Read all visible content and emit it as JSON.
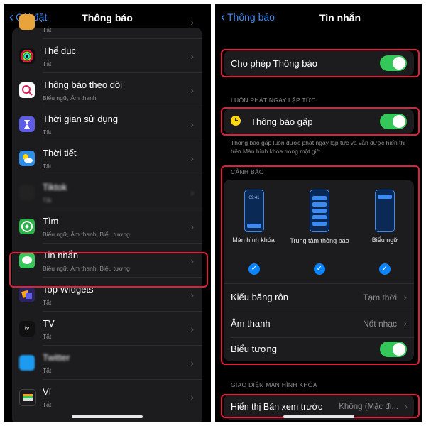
{
  "left": {
    "back_label": "Cài đặt",
    "title": "Thông báo",
    "items": [
      {
        "name": "",
        "sub": "Tắt"
      },
      {
        "name": "Thể dục",
        "sub": "Tắt"
      },
      {
        "name": "Thông báo theo dõi",
        "sub": "Biểu ngữ, Âm thanh"
      },
      {
        "name": "Thời gian sử dụng",
        "sub": "Tắt"
      },
      {
        "name": "Thời tiết",
        "sub": "Tắt"
      },
      {
        "name": "Tiktok",
        "sub": "Tắt"
      },
      {
        "name": "Tìm",
        "sub": "Biểu ngữ, Âm thanh, Biểu tượng"
      },
      {
        "name": "Tin nhắn",
        "sub": "Biểu ngữ, Âm thanh, Biểu tượng"
      },
      {
        "name": "Top Widgets",
        "sub": "Tắt"
      },
      {
        "name": "TV",
        "sub": "Tắt"
      },
      {
        "name": "Twitter",
        "sub": "Tắt"
      },
      {
        "name": "Ví",
        "sub": "Tắt"
      }
    ],
    "tv_icon_text": "tv"
  },
  "right": {
    "back_label": "Thông báo",
    "title": "Tin nhắn",
    "allow_label": "Cho phép Thông báo",
    "immediate_header": "LUÔN PHÁT NGAY LẬP TỨC",
    "urgent_label": "Thông báo gấp",
    "urgent_desc": "Thông báo gấp luôn được phát ngay lập tức và vẫn được hiển thị trên Màn hình khóa trong một giờ.",
    "alerts_header": "CẢNH BÁO",
    "lock_time": "09:41",
    "alert_lock": "Màn hình khóa",
    "alert_center": "Trung tâm thông báo",
    "alert_banner": "Biểu ngữ",
    "banner_style_label": "Kiểu băng rôn",
    "banner_style_value": "Tạm thời",
    "sound_label": "Âm thanh",
    "sound_value": "Nốt nhạc",
    "badge_label": "Biểu tượng",
    "lock_appearance_header": "GIAO DIỆN MÀN HÌNH KHÓA",
    "preview_label": "Hiển thị Bản xem trước",
    "preview_value": "Không (Mặc đị..."
  },
  "colors": {
    "accent": "#3d8bf2",
    "toggle_on": "#34c759",
    "highlight": "#e0203a"
  }
}
